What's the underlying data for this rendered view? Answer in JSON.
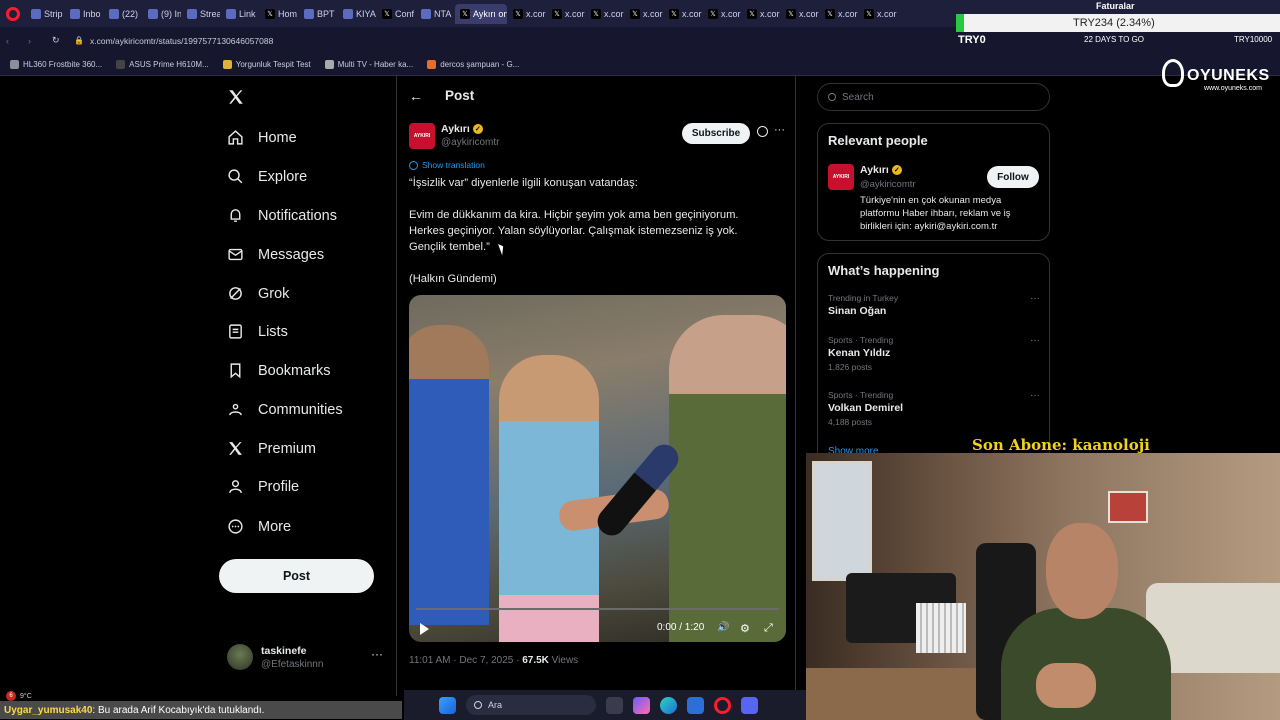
{
  "browser": {
    "tabs": [
      "Strip",
      "Inbo",
      "(22)",
      "(9) In",
      "Strea",
      "Link",
      "Hom",
      "BPT",
      "KIYA",
      "Conf",
      "NTA",
      "Aykırı on",
      "x.cor",
      "x.cor",
      "x.cor",
      "x.cor",
      "x.cor",
      "x.cor",
      "x.cor",
      "x.cor",
      "x.cor",
      "x.cor"
    ],
    "url": "x.com/aykiricomtr/status/1997577130646057088",
    "bookmarks": [
      "HL360 Frostbite 360...",
      "ASUS Prime H610M...",
      "Yorgunluk Tespit Test",
      "Multi TV - Haber ka...",
      "dercos şampuan - G..."
    ]
  },
  "overlay": {
    "goal_title": "Faturalar",
    "goal_amount": "TRY234 (2.34%)",
    "goal_current": "TRY0",
    "goal_days": "22 DAYS TO GO",
    "goal_target": "TRY10000",
    "sponsor_name": "OYUNEKS",
    "sponsor_url": "www.oyuneks.com",
    "last_sub": "Son Abone: kaanoloji",
    "chat_user": "Uygar_yumusak40",
    "chat_message": ": Bu arada Arif Kocabıyık'da tutuklandı.",
    "weather_badge": "6",
    "weather_temp": "9°C"
  },
  "nav": {
    "items": [
      "Home",
      "Explore",
      "Notifications",
      "Messages",
      "Grok",
      "Lists",
      "Bookmarks",
      "Communities",
      "Premium",
      "Profile",
      "More"
    ],
    "post_button": "Post",
    "account_name": "taskinefe",
    "account_handle": "@Efetaskinnn"
  },
  "post": {
    "header": "Post",
    "author_name": "Aykırı",
    "author_handle": "@aykiricomtr",
    "avatar_text": "AYKIRI",
    "subscribe": "Subscribe",
    "show_translation": "Show translation",
    "line1": "“İşsizlik var” diyenlerle ilgili konuşan vatandaş:",
    "line2": "Evim de dükkanım da kira. Hiçbir şeyim yok ama ben geçiniyorum.",
    "line3": "Herkes geçiniyor. Yalan söylüyorlar. Çalışmak istemezseniz iş yok.",
    "line4": "Gençlik tembel.”",
    "line5": "(Halkın Gündemi)",
    "video_time": "0:00 / 1:20",
    "video_progress": 0,
    "meta_time": "11:01 AM · Dec 7, 2025 · ",
    "views_count": "67.5K",
    "views_label": " Views"
  },
  "search": {
    "placeholder": "Search"
  },
  "relevant": {
    "title": "Relevant people",
    "name": "Aykırı",
    "handle": "@aykiricomtr",
    "follow": "Follow",
    "bio": "Türkiye'nin en çok okunan medya platformu Haber ihbarı, reklam ve iş birlikleri için: aykiri@aykiri.com.tr"
  },
  "happening": {
    "title": "What’s happening",
    "trends": [
      {
        "meta": "Trending in Turkey",
        "name": "Sinan Oğan",
        "posts": ""
      },
      {
        "meta": "Sports · Trending",
        "name": "Kenan Yıldız",
        "posts": "1,826 posts"
      },
      {
        "meta": "Sports · Trending",
        "name": "Volkan Demirel",
        "posts": "4,188 posts"
      }
    ],
    "show_more": "Show more"
  },
  "taskbar": {
    "search_label": "Ara"
  },
  "colors": {
    "accent": "#1d9bf0",
    "verified": "#e8b923",
    "goal_green": "#28c840",
    "last_sub": "#f2d21b",
    "chat_user": "#ffd84a"
  }
}
